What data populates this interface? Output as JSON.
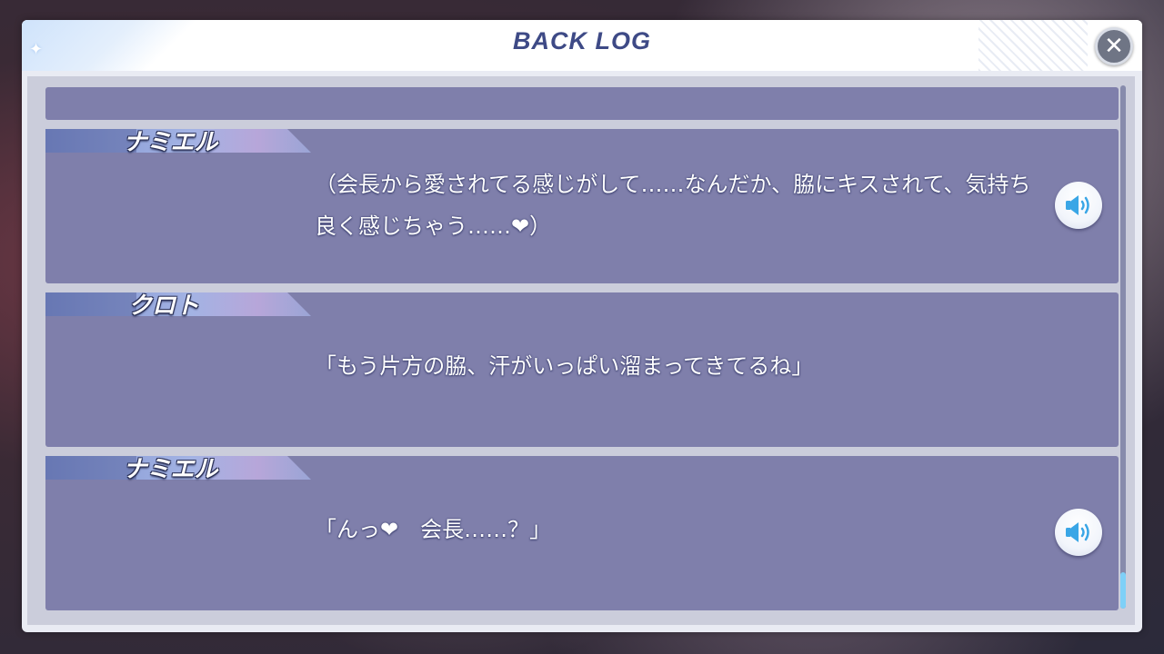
{
  "header": {
    "title": "BACK LOG",
    "close_icon": "close-icon"
  },
  "log": {
    "entries": [
      {
        "speaker": "ナミエル",
        "text": "（会長から愛されてる感じがして……なんだか、脇にキスされて、気持ち良く感じちゃう……❤）",
        "has_voice": true
      },
      {
        "speaker": "クロト",
        "text": "「もう片方の脇、汗がいっぱい溜まってきてるね」",
        "has_voice": false
      },
      {
        "speaker": "ナミエル",
        "text": "「んっ❤　会長……？」",
        "has_voice": true
      }
    ],
    "voice_icon": "speaker-volume-icon"
  },
  "scroll": {
    "position": "bottom"
  },
  "colors": {
    "title": "#3e4a86",
    "entry_bg": "#6e6ea0",
    "voice_icon": "#3aa6e6",
    "scroll_thumb": "#7fd0f7"
  }
}
